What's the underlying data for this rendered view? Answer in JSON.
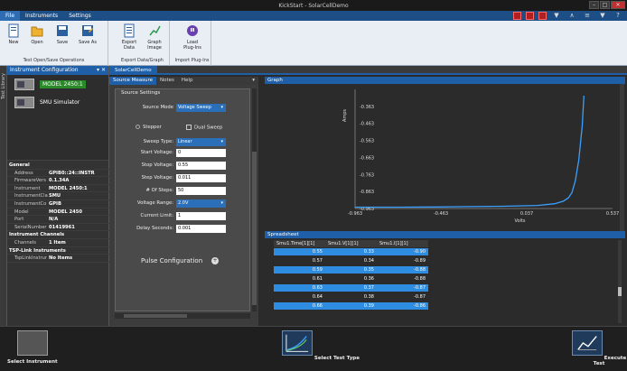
{
  "window": {
    "title": "KickStart - SolarCellDemo",
    "controls": [
      "–",
      "□",
      "✕"
    ]
  },
  "menu": {
    "tabs": [
      "File",
      "Instruments",
      "Settings"
    ]
  },
  "quick_icons": [
    "▼",
    "∧",
    "≡",
    "▼",
    "?"
  ],
  "ribbon": {
    "groups": [
      {
        "label": "Test Open/Save Operations",
        "buttons": [
          "New",
          "Open",
          "Save",
          "Save As"
        ]
      },
      {
        "label": "Export Data/Graph",
        "buttons": [
          "Export Data",
          "Graph Image"
        ]
      },
      {
        "label": "Import Plug-Ins",
        "buttons": [
          "Load Plug-Ins"
        ]
      }
    ]
  },
  "left_strip": {
    "label": "Test Library"
  },
  "instrument_panel": {
    "title": "Instrument Configuration",
    "instruments": [
      {
        "name": "MODEL 2450:1",
        "selected": true
      },
      {
        "name": "SMU Simulator",
        "selected": false
      }
    ],
    "properties": [
      {
        "category": "General"
      },
      {
        "key": "Address",
        "value": "GPIB0::24::INSTR"
      },
      {
        "key": "FirmwareVers",
        "value": "0.1.34A"
      },
      {
        "key": "Instrument",
        "value": "MODEL 2450:1"
      },
      {
        "key": "InstrumentCla",
        "value": "SMU"
      },
      {
        "key": "InstrumentCo",
        "value": "GPIB"
      },
      {
        "key": "Model",
        "value": "MODEL 2450"
      },
      {
        "key": "Port",
        "value": "N/A"
      },
      {
        "key": "SerialNumber",
        "value": "01419961"
      },
      {
        "category": "Instrument Channels"
      },
      {
        "key": "Channels",
        "value": "1 Item"
      },
      {
        "category": "TSP-Link Instruments"
      },
      {
        "key": "TspLinkInstrur",
        "value": "No Items"
      }
    ]
  },
  "document": {
    "tab": "SolarCellDemo"
  },
  "source_panel": {
    "subtabs": [
      "Source Measure",
      "Notes",
      "Help"
    ],
    "settings_title": "Source Settings",
    "source_mode_label": "Source Mode",
    "source_mode": "Voltage Sweep",
    "stepper_label": "Stepper",
    "dual_sweep_label": "Dual Sweep",
    "sweep_type_label": "Sweep Type:",
    "sweep_type": "Linear",
    "start_label": "Start Voltage:",
    "start_value": "0",
    "stop_label": "Stop Voltage:",
    "stop_value": "0.55",
    "step_label": "Step Voltage:",
    "step_value": "0.011",
    "steps_label": "# Of Steps:",
    "steps_value": "50",
    "range_label": "Voltage Range:",
    "range_value": "2.0V",
    "limit_label": "Current Limit:",
    "limit_value": "1",
    "delay_label": "Delay Seconds:",
    "delay_value": "0.001",
    "pulse_label": "Pulse Configuration",
    "pulse_icon": "+"
  },
  "graph": {
    "title": "Graph"
  },
  "chart_data": {
    "type": "line",
    "title": "",
    "xlabel": "Volts",
    "ylabel": "Amps",
    "xlim": [
      -0.963,
      0.537
    ],
    "ylim": [
      -0.963,
      -0.263
    ],
    "x_ticks": [
      "-0.963",
      "-0.463",
      "0.037",
      "0.537"
    ],
    "y_ticks": [
      "-0.363",
      "-0.463",
      "-0.563",
      "-0.663",
      "-0.763",
      "-0.863",
      "-0.963"
    ],
    "series": [
      {
        "name": "",
        "color": "#3aa0ff",
        "x": [
          -0.963,
          -0.7,
          -0.5,
          -0.3,
          -0.1,
          0.1,
          0.2,
          0.25,
          0.28,
          0.3,
          0.32,
          0.34,
          0.36,
          0.37
        ],
        "y": [
          -0.955,
          -0.955,
          -0.954,
          -0.952,
          -0.95,
          -0.945,
          -0.935,
          -0.92,
          -0.9,
          -0.87,
          -0.8,
          -0.68,
          -0.48,
          -0.3
        ]
      }
    ],
    "grid": false
  },
  "spreadsheet": {
    "title": "Spreadsheet",
    "columns": [
      "Smu1.Time[1][1]",
      "Smu1.V[1][1]",
      "Smu1.I[1][1]"
    ],
    "rows": [
      {
        "cells": [
          "0.55",
          "0.33",
          "-0.90"
        ],
        "highlight": true
      },
      {
        "cells": [
          "0.57",
          "0.34",
          "-0.89"
        ],
        "highlight": false
      },
      {
        "cells": [
          "0.59",
          "0.35",
          "-0.88"
        ],
        "highlight": true
      },
      {
        "cells": [
          "0.61",
          "0.36",
          "-0.88"
        ],
        "highlight": false
      },
      {
        "cells": [
          "0.63",
          "0.37",
          "-0.87"
        ],
        "highlight": true
      },
      {
        "cells": [
          "0.64",
          "0.38",
          "-0.87"
        ],
        "highlight": false
      },
      {
        "cells": [
          "0.66",
          "0.39",
          "-0.86"
        ],
        "highlight": true
      }
    ]
  },
  "bottom_bar": {
    "select_instrument": "Select Instrument",
    "select_test_type": "Select Test Type",
    "execute_test": "Execute Test"
  }
}
